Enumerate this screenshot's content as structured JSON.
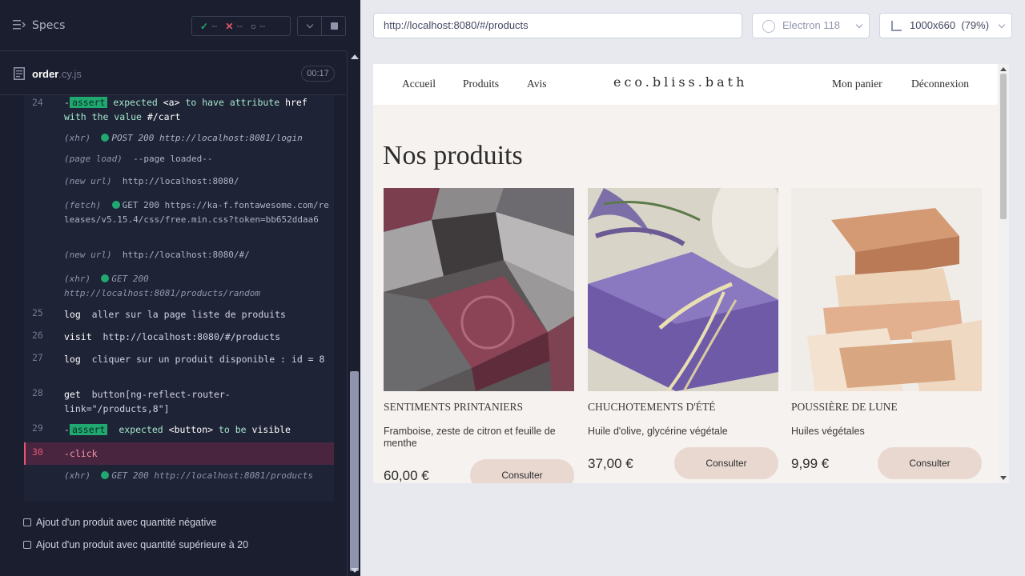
{
  "runner": {
    "specs_title": "Specs",
    "stats": {
      "passed": "--",
      "failed": "--",
      "pending": "--"
    },
    "file": {
      "name": "order",
      "ext": ".cy.js",
      "timer": "00:17"
    },
    "commands": [
      {
        "num": "24",
        "text_parts": [
          "-",
          "assert",
          " expected ",
          "<a>",
          " to have attribute ",
          "href",
          " with the value ",
          "#/cart"
        ]
      },
      {
        "sub": "(xhr)",
        "text": "POST 200 http://localhost:8081/login"
      },
      {
        "sub": "(page load)",
        "text": "--page loaded--"
      },
      {
        "sub": "(new url)",
        "text": "http://localhost:8080/"
      },
      {
        "sub": "(fetch)",
        "text": "GET 200 https://ka-f.fontawesome.com/releases/v5.15.4/css/free.min.css?token=bb652ddaa6"
      },
      {
        "sub": "(new url)",
        "text": "http://localhost:8080/#/"
      },
      {
        "sub": "(xhr)",
        "text": "GET 200 http://localhost:8081/products/random"
      },
      {
        "num": "25",
        "name": "log",
        "text": "aller sur la page liste de produits"
      },
      {
        "num": "26",
        "name": "visit",
        "text": "http://localhost:8080/#/products"
      },
      {
        "num": "27",
        "name": "log",
        "text": "cliquer sur un produit disponible : id = 8"
      },
      {
        "num": "28",
        "name": "get",
        "text": "button[ng-reflect-router-link=\"/products,8\"]"
      },
      {
        "num": "29",
        "name": "assert",
        "text_parts": [
          "expected ",
          "<button>",
          " to be ",
          "visible"
        ]
      },
      {
        "num": "30",
        "name": "-click"
      },
      {
        "sub": "(xhr)",
        "text": "GET 200 http://localhost:8081/products"
      }
    ],
    "tests": [
      "Ajout d'un produit avec quantité négative",
      "Ajout d'un produit avec quantité supérieure à 20"
    ]
  },
  "aut": {
    "url": "http://localhost:8080/#/products",
    "browser": "Electron 118",
    "viewport": "1000x660",
    "zoom": "(79%)",
    "nav": {
      "links_left": [
        "Accueil",
        "Produits",
        "Avis"
      ],
      "logo": "eco.bliss.bath",
      "links_right": [
        "Mon panier",
        "Déconnexion"
      ]
    },
    "page_title": "Nos produits",
    "products": [
      {
        "name": "SENTIMENTS PRINTANIERS",
        "desc": "Framboise, zeste de citron et feuille de menthe",
        "price": "60,00 €",
        "button": "Consulter"
      },
      {
        "name": "CHUCHOTEMENTS D'ÉTÉ",
        "desc": "Huile d'olive, glycérine végétale",
        "price": "37,00 €",
        "button": "Consulter"
      },
      {
        "name": "POUSSIÈRE DE LUNE",
        "desc": "Huiles végétales",
        "price": "9,99 €",
        "button": "Consulter"
      }
    ]
  }
}
